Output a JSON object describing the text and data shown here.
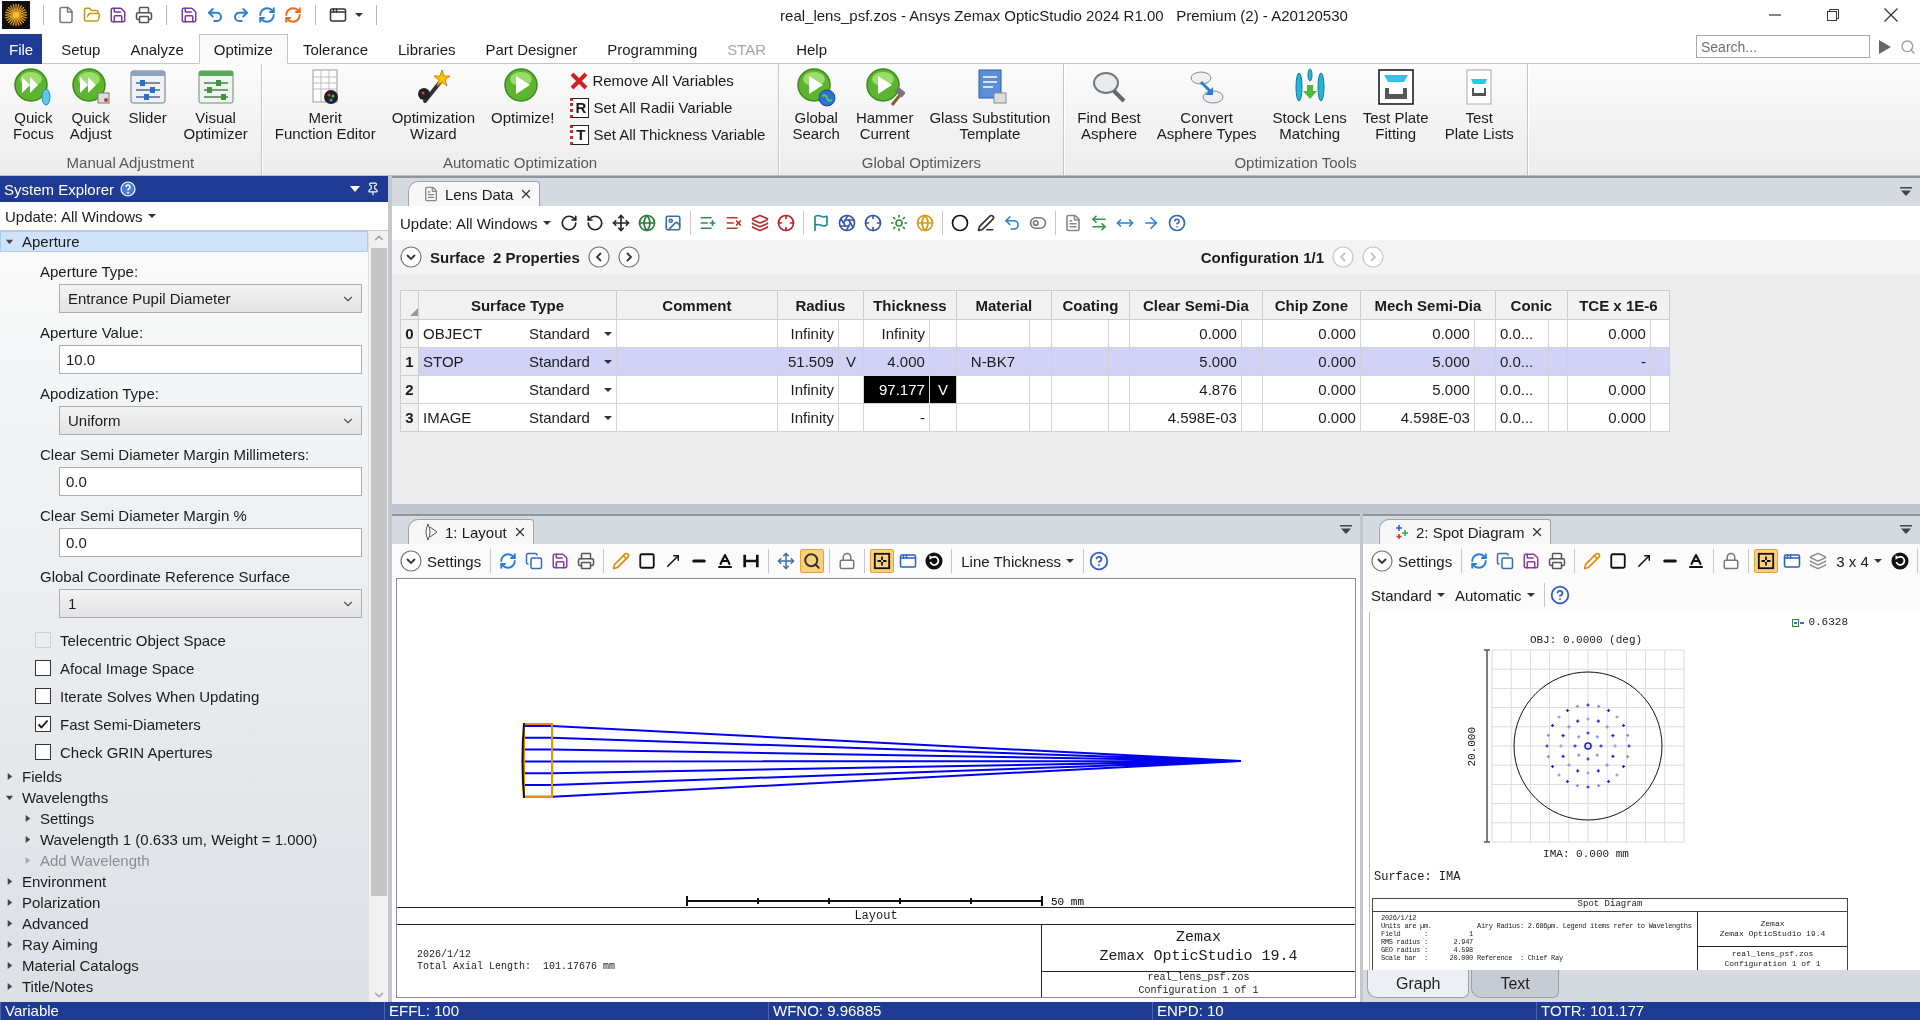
{
  "title_bar": {
    "title": "real_lens_psf.zos - Ansys Zemax OpticStudio 2024 R1.00   Premium (2) - A20120530"
  },
  "menu_tabs": [
    {
      "label": "File",
      "kind": "file",
      "selected": false,
      "disabled": false
    },
    {
      "label": "Setup",
      "kind": "tab",
      "selected": false,
      "disabled": false
    },
    {
      "label": "Analyze",
      "kind": "tab",
      "selected": false,
      "disabled": false
    },
    {
      "label": "Optimize",
      "kind": "tab",
      "selected": true,
      "disabled": false
    },
    {
      "label": "Tolerance",
      "kind": "tab",
      "selected": false,
      "disabled": false
    },
    {
      "label": "Libraries",
      "kind": "tab",
      "selected": false,
      "disabled": false
    },
    {
      "label": "Part Designer",
      "kind": "tab",
      "selected": false,
      "disabled": false
    },
    {
      "label": "Programming",
      "kind": "tab",
      "selected": false,
      "disabled": false
    },
    {
      "label": "STAR",
      "kind": "tab",
      "selected": false,
      "disabled": true
    },
    {
      "label": "Help",
      "kind": "tab",
      "selected": false,
      "disabled": false
    }
  ],
  "search": {
    "placeholder": "Search..."
  },
  "ribbon_groups": [
    {
      "label": "Manual Adjustment",
      "buttons": [
        {
          "label": "Quick\nFocus",
          "kind": "large"
        },
        {
          "label": "Quick\nAdjust",
          "kind": "large"
        },
        {
          "label": "Slider",
          "kind": "large"
        },
        {
          "label": "Visual\nOptimizer",
          "kind": "large"
        }
      ]
    },
    {
      "label": "Automatic Optimization",
      "buttons": [
        {
          "label": "Merit\nFunction Editor",
          "kind": "large"
        },
        {
          "label": "Optimization\nWizard",
          "kind": "large"
        },
        {
          "label": "Optimize!",
          "kind": "large"
        },
        {
          "label": "Remove All Variables",
          "kind": "small"
        },
        {
          "label": "Set All Radii Variable",
          "kind": "small",
          "glyph": "R"
        },
        {
          "label": "Set All Thickness Variable",
          "kind": "small",
          "glyph": "T"
        }
      ]
    },
    {
      "label": "Global Optimizers",
      "buttons": [
        {
          "label": "Global\nSearch",
          "kind": "large"
        },
        {
          "label": "Hammer\nCurrent",
          "kind": "large"
        },
        {
          "label": "Glass Substitution\nTemplate",
          "kind": "large"
        }
      ]
    },
    {
      "label": "Optimization Tools",
      "buttons": [
        {
          "label": "Find Best\nAsphere",
          "kind": "large"
        },
        {
          "label": "Convert\nAsphere Types",
          "kind": "large"
        },
        {
          "label": "Stock Lens\nMatching",
          "kind": "large"
        },
        {
          "label": "Test Plate\nFitting",
          "kind": "large"
        },
        {
          "label": "Test\nPlate Lists",
          "kind": "large"
        }
      ]
    }
  ],
  "system_explorer": {
    "title": "System Explorer",
    "update": "Update: All Windows",
    "tree": [
      {
        "label": "Aperture",
        "expanded": true,
        "selected": true,
        "fields": [
          {
            "kind": "dropdown",
            "label": "Aperture Type:",
            "value": "Entrance Pupil Diameter"
          },
          {
            "kind": "input",
            "label": "Aperture Value:",
            "value": "10.0"
          },
          {
            "kind": "dropdown",
            "label": "Apodization Type:",
            "value": "Uniform"
          },
          {
            "kind": "input",
            "label": "Clear Semi Diameter Margin Millimeters:",
            "value": "0.0"
          },
          {
            "kind": "input",
            "label": "Clear Semi Diameter Margin %",
            "value": "0.0"
          },
          {
            "kind": "dropdown",
            "label": "Global Coordinate Reference Surface",
            "value": "1"
          }
        ],
        "checkboxes": [
          {
            "label": "Telecentric Object Space",
            "checked": false,
            "disabled": true
          },
          {
            "label": "Afocal Image Space",
            "checked": false,
            "disabled": false
          },
          {
            "label": "Iterate Solves When Updating",
            "checked": false,
            "disabled": false
          },
          {
            "label": "Fast Semi-Diameters",
            "checked": true,
            "disabled": false
          },
          {
            "label": "Check GRIN Apertures",
            "checked": false,
            "disabled": false
          }
        ]
      },
      {
        "label": "Fields",
        "expanded": false,
        "selected": false
      },
      {
        "label": "Wavelengths",
        "expanded": true,
        "selected": false,
        "children": [
          {
            "label": "Settings",
            "expanded": false,
            "disabled": false
          },
          {
            "label": "Wavelength 1 (0.633 um, Weight = 1.000)",
            "expanded": false,
            "disabled": false
          },
          {
            "label": "Add Wavelength",
            "expanded": false,
            "disabled": true
          }
        ]
      },
      {
        "label": "Environment",
        "expanded": false,
        "selected": false
      },
      {
        "label": "Polarization",
        "expanded": false,
        "selected": false
      },
      {
        "label": "Advanced",
        "expanded": false,
        "selected": false
      },
      {
        "label": "Ray Aiming",
        "expanded": false,
        "selected": false
      },
      {
        "label": "Material Catalogs",
        "expanded": false,
        "selected": false
      },
      {
        "label": "Title/Notes",
        "expanded": false,
        "selected": false
      }
    ]
  },
  "lens_data": {
    "tab": "Lens Data",
    "update": "Update: All Windows",
    "surface": "Surface",
    "properties": "2 Properties",
    "configuration": "Configuration 1/1",
    "columns": [
      "Surface Type",
      "Comment",
      "Radius",
      "Thickness",
      "Material",
      "Coating",
      "Clear Semi-Dia",
      "Chip Zone",
      "Mech Semi-Dia",
      "Conic",
      "TCE x 1E-6"
    ],
    "rows": [
      {
        "number": "0",
        "selected": false,
        "cells": [
          {
            "name": "OBJECT",
            "value": "Standard",
            "selected": false
          },
          {
            "selected": false
          },
          {
            "value": "Infinity",
            "selected": false
          },
          {
            "value": "Infinity",
            "selected": false
          },
          {
            "selected": false
          },
          {
            "selected": false
          },
          {
            "value": "0.000",
            "selected": false
          },
          {
            "value": "0.000",
            "selected": false
          },
          {
            "value": "0.000",
            "selected": false
          },
          {
            "value": "0.0...",
            "selected": false
          },
          {
            "value": "0.000",
            "selected": false
          }
        ]
      },
      {
        "number": "1",
        "selected": true,
        "cells": [
          {
            "name": "STOP",
            "value": "Standard",
            "selected": false
          },
          {
            "selected": false
          },
          {
            "value": "51.509",
            "solve": "V",
            "selected": false
          },
          {
            "value": "4.000",
            "selected": false
          },
          {
            "value": "N-BK7",
            "selected": false
          },
          {
            "selected": false
          },
          {
            "value": "5.000",
            "selected": false
          },
          {
            "value": "0.000",
            "selected": false
          },
          {
            "value": "5.000",
            "selected": false
          },
          {
            "value": "0.0...",
            "selected": false
          },
          {
            "value": "-",
            "selected": false
          }
        ]
      },
      {
        "number": "2",
        "selected": false,
        "cells": [
          {
            "value": "Standard",
            "selected": false
          },
          {
            "selected": false
          },
          {
            "value": "Infinity",
            "selected": false
          },
          {
            "value": "97.177",
            "solve": "V",
            "selected": true
          },
          {
            "selected": false
          },
          {
            "selected": false
          },
          {
            "value": "4.876",
            "selected": false
          },
          {
            "value": "0.000",
            "selected": false
          },
          {
            "value": "5.000",
            "selected": false
          },
          {
            "value": "0.0...",
            "selected": false
          },
          {
            "value": "0.000",
            "selected": false
          }
        ]
      },
      {
        "number": "3",
        "selected": false,
        "cells": [
          {
            "name": "IMAGE",
            "value": "Standard",
            "selected": false
          },
          {
            "selected": false
          },
          {
            "value": "Infinity",
            "selected": false
          },
          {
            "value": "-",
            "selected": false
          },
          {
            "selected": false
          },
          {
            "selected": false
          },
          {
            "value": "4.598E-03",
            "selected": false
          },
          {
            "value": "0.000",
            "selected": false
          },
          {
            "value": "4.598E-03",
            "selected": false
          },
          {
            "value": "0.0...",
            "selected": false
          },
          {
            "value": "0.000",
            "selected": false
          }
        ]
      }
    ]
  },
  "layout_window": {
    "tab": "1: Layout",
    "settings": "Settings",
    "tools": [
      {
        "selected": false
      },
      {
        "selected": false
      },
      {
        "selected": false
      },
      {
        "selected": false
      },
      {
        "selected": false
      },
      {
        "selected": false
      },
      {
        "selected": false
      },
      {
        "selected": false
      },
      {
        "selected": false
      },
      {
        "selected": false
      },
      {
        "selected": false
      },
      {
        "selected": true
      },
      {
        "selected": false
      },
      {
        "selected": true
      },
      {
        "selected": false
      },
      {
        "selected": false
      }
    ],
    "line_thickness": "Line Thickness",
    "scale_label": "50 mm",
    "title_block": {
      "heading": "Layout",
      "date": "2026/1/12",
      "info": "Total Axial Length:  101.17676 mm",
      "company": "Zemax",
      "product": "Zemax OpticStudio 19.4",
      "file": "real_lens_psf.zos",
      "configuration": "Configuration 1 of 1"
    }
  },
  "spot_window": {
    "tab": "2: Spot Diagram",
    "settings": "Settings",
    "tools": [
      {
        "selected": false
      },
      {
        "selected": false
      },
      {
        "selected": false
      },
      {
        "selected": false
      },
      {
        "selected": false
      },
      {
        "selected": false
      },
      {
        "selected": false
      },
      {
        "selected": false
      },
      {
        "selected": false
      },
      {
        "selected": false
      },
      {
        "selected": true
      },
      {
        "selected": false
      },
      {
        "selected": false
      },
      {
        "selected": false
      }
    ],
    "grid_size": "3 x 4",
    "plot_type": "Standard",
    "scaling": "Automatic",
    "legend": "0.6328",
    "field_label": "OBJ: 0.0000 (deg)",
    "scale_label": "20.000",
    "image_label": "IMA: 0.000 mm",
    "surface_label": "Surface: IMA",
    "title_block": {
      "heading": "Spot Diagram",
      "notes": [
        {
          "label": "2026/1/12"
        },
        {
          "label": "Units are µm.",
          "note": "Airy Radius: 2.686µm. Legend items refer to Wavelengths"
        },
        {
          "label": "Field      :",
          "value": "1"
        },
        {
          "label": "RMS radius :",
          "value": "2.947"
        },
        {
          "label": "GEO radius :",
          "value": "4.598"
        },
        {
          "label": "Scale bar  :",
          "value": "20.000",
          "note": "Reference  : Chief Ray"
        }
      ],
      "company": "Zemax",
      "product": "Zemax OpticStudio 19.4",
      "file": "real_lens_psf.zos",
      "configuration": "Configuration 1 of 1"
    },
    "view_tabs": [
      {
        "label": "Graph",
        "selected": true
      },
      {
        "label": "Text",
        "selected": false
      }
    ]
  },
  "status_bar": [
    "Variable",
    "EFFL: 100",
    "WFNO: 9.96885",
    "ENPD: 10",
    "TOTR: 101.177"
  ]
}
